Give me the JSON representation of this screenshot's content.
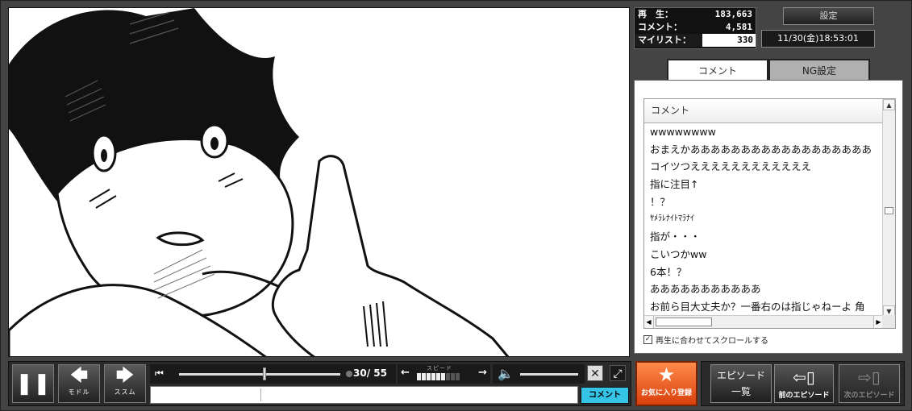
{
  "stats": {
    "views_label": "再　生：",
    "views": "183,663",
    "comments_label": "コメント：",
    "comments": "4,581",
    "mylist_label": "マイリスト：",
    "mylist": "330"
  },
  "header": {
    "settings_label": "設定",
    "datetime": "11/30(金)18:53:01"
  },
  "tabs": [
    {
      "label": "コメント",
      "active": true
    },
    {
      "label": "NG設定",
      "active": false
    }
  ],
  "comment_list": {
    "header": "コメント",
    "rows": [
      "wwwwwwww",
      "おまえかああああああああああああああああああ",
      "コイツつええええええええええええ",
      "指に注目↑",
      "！？",
      "ﾔﾒﾗﾚﾅｲﾄﾏﾗﾅｲ",
      "指が・・・",
      "こいつかww",
      "6本！？",
      "あああああああああああ",
      "お前ら目大丈夫か？一番右のは指じゃねーよ 角"
    ],
    "sync_label": "再生に合わせてスクロールする",
    "sync_checked": true
  },
  "controls": {
    "pause_glyph": "❚❚",
    "back_label": "モドル",
    "forward_label": "ススム",
    "seek_start_glyph": "⏮",
    "time": "30/ 55",
    "speed_label": "スピード",
    "speed_left": "←",
    "speed_right": "→",
    "speed_level": 6,
    "speed_total": 9,
    "volume_glyph": "🔈",
    "ng_glyph": "✕",
    "fullscreen_glyph": "⤢",
    "comment_button_label": "コメント"
  },
  "favorite": {
    "star": "★",
    "label": "お気に入り登録"
  },
  "episodes": {
    "list_line1": "エピソード",
    "list_line2": "一覧",
    "prev_label": "前のエピソード",
    "next_label": "次のエピソード"
  }
}
